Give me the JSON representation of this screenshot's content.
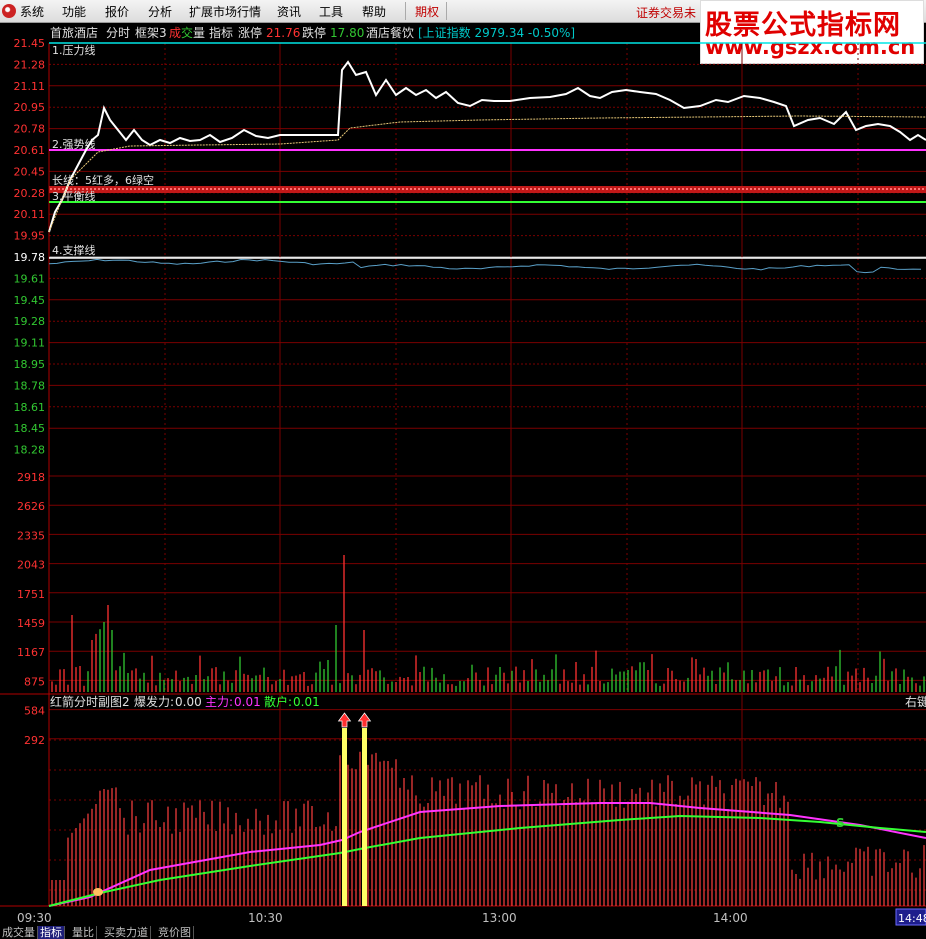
{
  "menu": {
    "items": [
      "系统",
      "功能",
      "报价",
      "分析",
      "扩展市场行情",
      "资讯",
      "工具",
      "帮助"
    ],
    "options_label": "期权",
    "notice": "证券交易未"
  },
  "watermark": {
    "line1": "股票公式指标网",
    "line2": "www.gszx.com.cn"
  },
  "header": {
    "stock_name": "首旅酒店",
    "mode": "分时",
    "frame": "框架3",
    "vol_a": "成",
    "vol_b": "交",
    "vol_c": "量",
    "indicator": "指标",
    "limit_up_label": "涨停",
    "limit_up_value": "21.76",
    "limit_down_label": "跌停",
    "limit_down_value": "17.80",
    "sector": "酒店餐饮",
    "index_text": "[上证指数 2979.34 -0.50%]"
  },
  "price_axis": {
    "red": [
      "21.45",
      "21.28",
      "21.11",
      "20.95",
      "20.78",
      "20.61",
      "20.45",
      "20.28",
      "20.11",
      "19.95"
    ],
    "white": "19.78",
    "green": [
      "19.61",
      "19.45",
      "19.28",
      "19.11",
      "18.95",
      "18.78",
      "18.61",
      "18.45",
      "18.28"
    ]
  },
  "volume_axis": [
    "2918",
    "2626",
    "2335",
    "2043",
    "1751",
    "1459",
    "1167",
    "875",
    "584",
    "292"
  ],
  "lines": {
    "pressure": "1.压力线",
    "strong": "2.强势线",
    "longshort": "长线：5红多，6绿空",
    "balance": "3.平衡线",
    "support": "4.支撑线"
  },
  "sub_panel": {
    "title": "红箭分时副图2",
    "burst_label": "爆发力:",
    "burst_value": "0.00",
    "main_label": "主力:",
    "main_value": "0.01",
    "retail_label": "散户:",
    "retail_value": "0.01",
    "right_label": "右键",
    "marker_s": "S"
  },
  "time_axis": [
    "09:30",
    "10:30",
    "13:00",
    "14:00"
  ],
  "current_time": "14:48",
  "bottom_tabs": [
    "成交量",
    "指标",
    "量比",
    "买卖力道",
    "竞价图"
  ],
  "colors": {
    "up": "#ff3232",
    "down": "#32c832",
    "grid": "#7a0000",
    "pressure_line": "#00e5e5",
    "strong_line": "#ff33ff",
    "balance_line": "#33ff33",
    "support_line": "#ffffff",
    "main_force": "#ff33ff",
    "retail": "#33ff33",
    "arrow_bar": "#ffff66"
  }
}
